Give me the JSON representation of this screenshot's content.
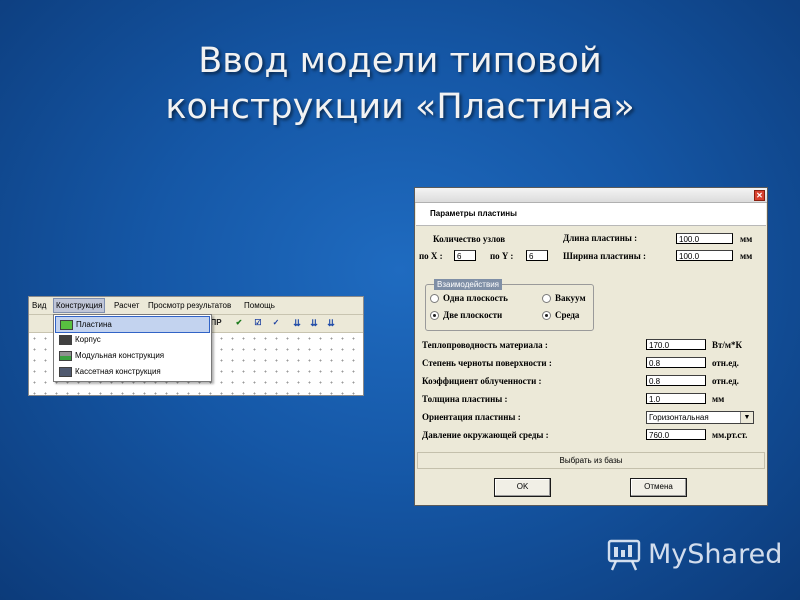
{
  "slide": {
    "title_line1": "Ввод модели типовой",
    "title_line2": "конструкции «Пластина»"
  },
  "app": {
    "menu": [
      "Вид",
      "Конструкция",
      "Расчет",
      "Просмотр результатов",
      "Помощь"
    ],
    "active_menu": "Конструкция",
    "toolbar": {
      "pr_label": "ПР",
      "delete_icon": "x-icon",
      "icons": [
        "check-icon",
        "verify-icon",
        "export-icon",
        "export-icon",
        "export-icon"
      ]
    },
    "dropdown": [
      {
        "label": "Пластина",
        "icon": "plate-icon",
        "selected": true
      },
      {
        "label": "Корпус",
        "icon": "case-icon",
        "selected": false
      },
      {
        "label": "Модульная конструкция",
        "icon": "module-icon",
        "selected": false
      },
      {
        "label": "Кассетная конструкция",
        "icon": "cassette-icon",
        "selected": false
      }
    ]
  },
  "dialog": {
    "title": "Параметры пластины",
    "nodes": {
      "label": "Количество узлов",
      "x_label": "по X :",
      "x_value": "6",
      "y_label": "по Y :",
      "y_value": "6"
    },
    "length": {
      "label": "Длина пластины :",
      "value": "100.0",
      "unit": "мм"
    },
    "width": {
      "label": "Ширина пластины :",
      "value": "100.0",
      "unit": "мм"
    },
    "interaction": {
      "title": "Взаимодействия",
      "one_plane": "Одна плоскость",
      "two_planes": "Две плоскости",
      "vacuum": "Вакуум",
      "medium": "Среда",
      "selected_planes": "Две плоскости",
      "selected_env": "Среда"
    },
    "params": [
      {
        "label": "Теплопроводность материала :",
        "value": "170.0",
        "unit": "Вт/м*К"
      },
      {
        "label": "Степень черноты поверхности :",
        "value": "0.8",
        "unit": "отн.ед."
      },
      {
        "label": "Коэффициент облученности :",
        "value": "0.8",
        "unit": "отн.ед."
      },
      {
        "label": "Толщина пластины :",
        "value": "1.0",
        "unit": "мм"
      }
    ],
    "orientation": {
      "label": "Ориентация пластины :",
      "value": "Горизонтальная"
    },
    "pressure": {
      "label": "Давление окружающей среды :",
      "value": "760.0",
      "unit": "мм.рт.ст."
    },
    "choose_from_db": "Выбрать из базы",
    "ok": "OK",
    "cancel": "Отмена"
  },
  "watermark": {
    "text": "MyShared"
  },
  "colors": {
    "background": "#1557a6",
    "title_text": "#f2f2f2",
    "dialog_bg": "#ece9d8",
    "selection": "#c3d3ef"
  }
}
